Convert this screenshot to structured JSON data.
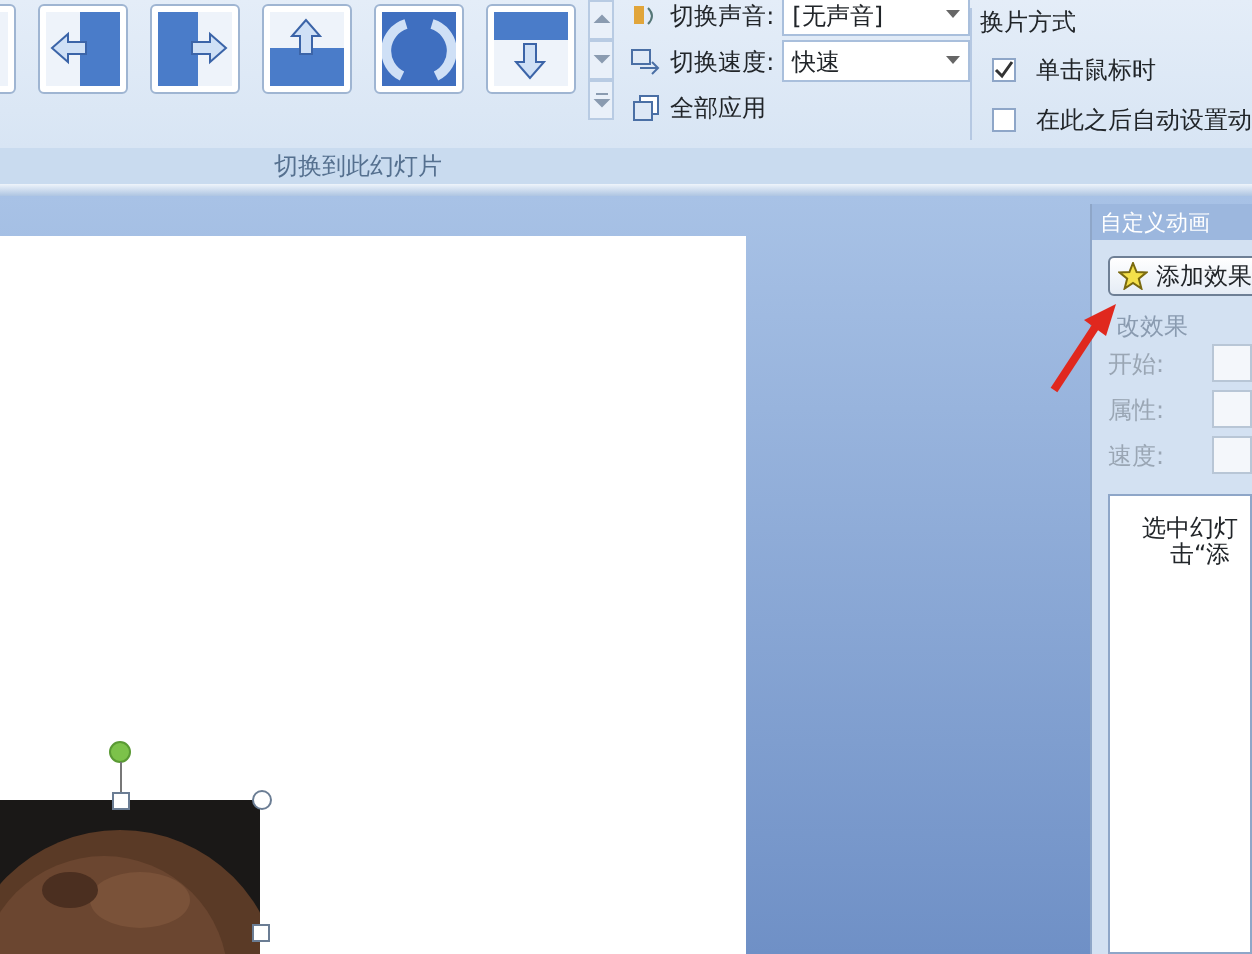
{
  "ribbon": {
    "sound": {
      "label": "切换声音:",
      "value": "[无声音]"
    },
    "speed": {
      "label": "切换速度:",
      "value": "快速"
    },
    "apply_all": "全部应用",
    "advance": {
      "title": "换片方式",
      "options": [
        {
          "label": "单击鼠标时",
          "checked": true
        },
        {
          "label": "在此之后自动设置动",
          "checked": false
        }
      ]
    },
    "group_label": "切换到此幻灯片"
  },
  "pane": {
    "title": "自定义动画",
    "add_button": "添加效果",
    "section": "改效果",
    "fields": [
      {
        "label": "开始:",
        "disabled": true
      },
      {
        "label": "属性:",
        "disabled": true
      },
      {
        "label": "速度:",
        "disabled": true
      }
    ],
    "hint": [
      "选中幻灯",
      "击“添"
    ]
  }
}
